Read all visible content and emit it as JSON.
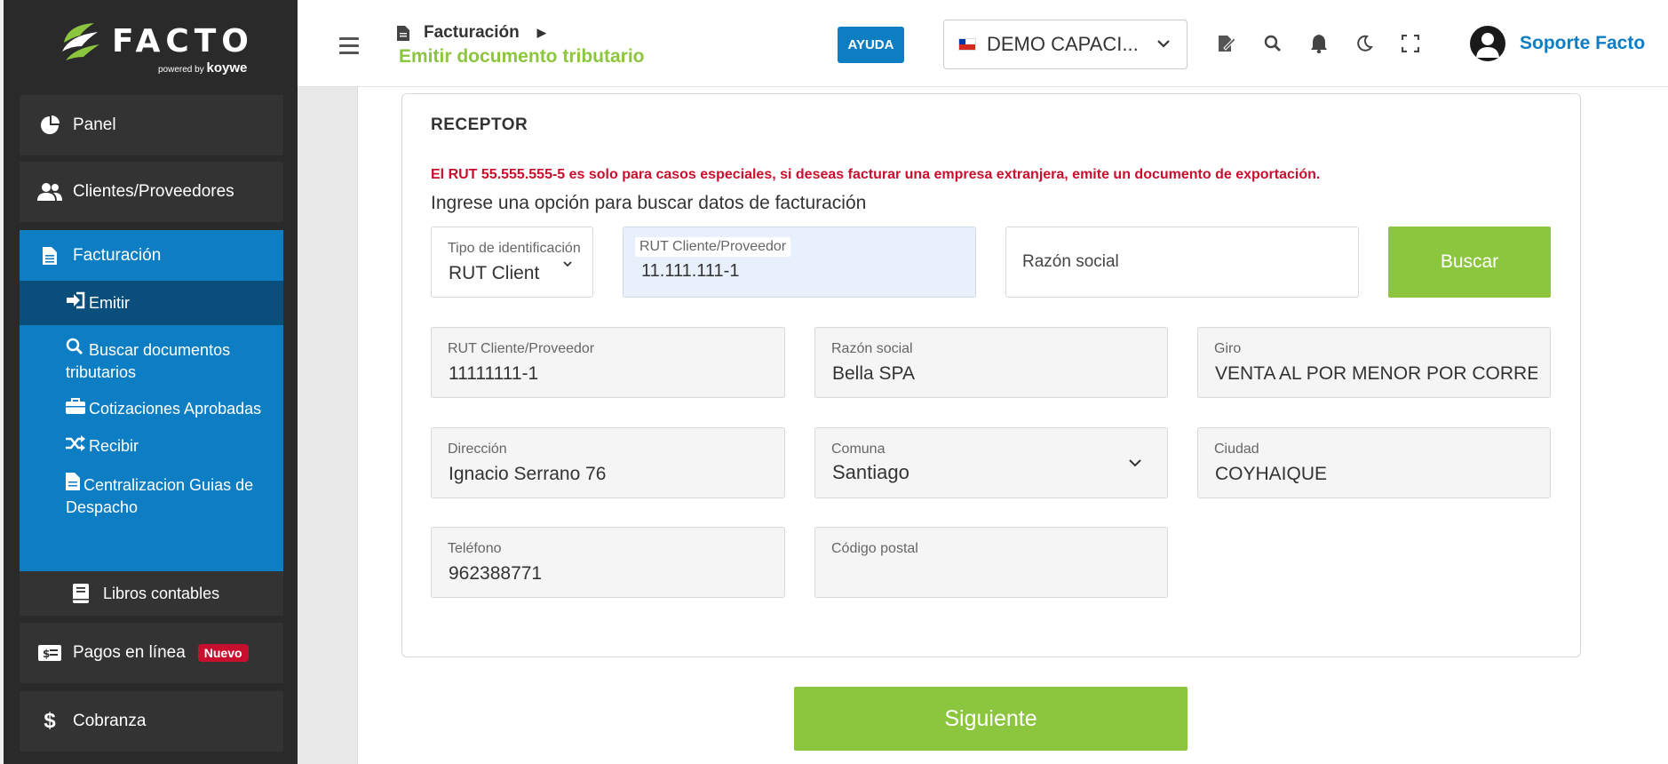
{
  "brand": {
    "name": "FACTO",
    "powered": "powered",
    "by": "by",
    "partner": "koywe"
  },
  "sidebar": {
    "panel": "Panel",
    "clientes": "Clientes/Proveedores",
    "facturacion": "Facturación",
    "sub": [
      {
        "label": "Emitir"
      },
      {
        "label": "Buscar documentos tributarios"
      },
      {
        "label": "Cotizaciones Aprobadas"
      },
      {
        "label": "Recibir"
      },
      {
        "label": "Centralizacion Guias de Despacho"
      }
    ],
    "libros": "Libros contables",
    "pagos": "Pagos en línea",
    "pagos_badge": "Nuevo",
    "cobranza": "Cobranza"
  },
  "header": {
    "breadcrumb": "Facturación",
    "page_title": "Emitir documento tributario",
    "help": "AYUDA",
    "company": "DEMO CAPACI...",
    "user": "Soporte Facto"
  },
  "receptor": {
    "title": "RECEPTOR",
    "warning": "El RUT 55.555.555-5 es solo para casos especiales, si deseas facturar una empresa extranjera, emite un documento de exportación.",
    "prompt": "Ingrese una opción para buscar datos de facturación",
    "search": {
      "tipo_label": "Tipo de identificación",
      "tipo_value": "RUT Client",
      "rut_label": "RUT Cliente/Proveedor",
      "rut_value": "11.111.111-1",
      "razon_placeholder": "Razón social",
      "buscar": "Buscar"
    },
    "fields": {
      "rut": {
        "label": "RUT Cliente/Proveedor",
        "value": "11111111-1"
      },
      "razon": {
        "label": "Razón social",
        "value": "Bella SPA"
      },
      "giro": {
        "label": "Giro",
        "value": "VENTA AL POR MENOR POR CORREO"
      },
      "direccion": {
        "label": "Dirección",
        "value": "Ignacio Serrano 76"
      },
      "comuna": {
        "label": "Comuna",
        "value": "Santiago"
      },
      "ciudad": {
        "label": "Ciudad",
        "value": "COYHAIQUE"
      },
      "telefono": {
        "label": "Teléfono",
        "value": "962388771"
      },
      "postal": {
        "label": "Código postal",
        "value": ""
      }
    }
  },
  "siguiente": "Siguiente",
  "colors": {
    "accent_green": "#8cc63f",
    "accent_blue": "#0d7ec4",
    "warning_red": "#c8102e",
    "sidebar": "#2a2a2a"
  }
}
